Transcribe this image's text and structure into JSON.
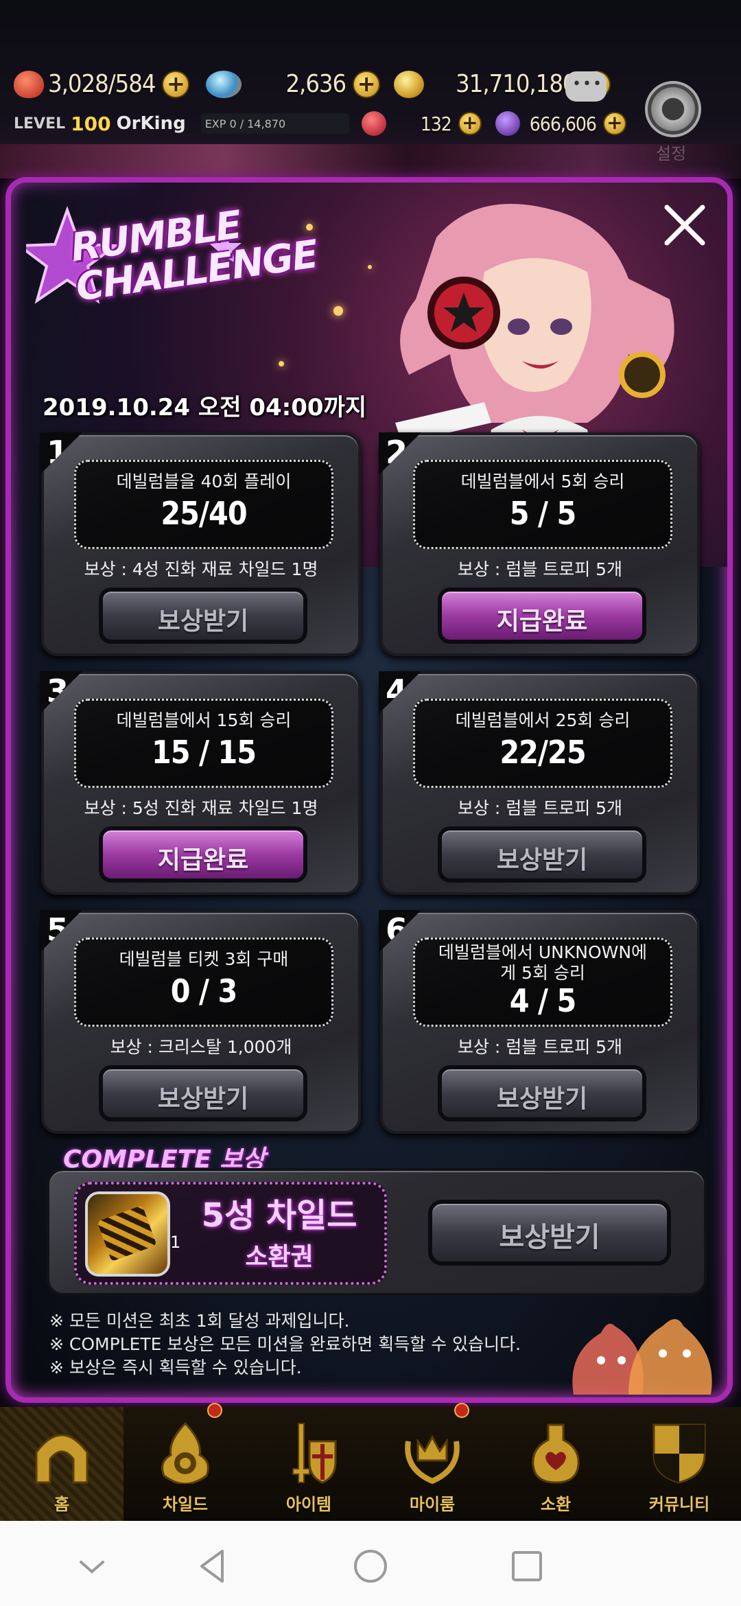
{
  "hud": {
    "hearts": "3,028",
    "hearts_max": "/584",
    "gems": "2,636",
    "coins": "31,710,180",
    "level_label": "LEVEL",
    "level": "100",
    "player_name": "OrKing",
    "exp": "EXP 0 / 14,870",
    "ruby": "132",
    "souls": "666,606",
    "settings_label": "설정"
  },
  "event": {
    "title_line1": "RUMBLE",
    "title_line2": "CHALLENGE",
    "deadline": "2019.10.24 오전 04:00까지"
  },
  "missions": [
    {
      "num": "1",
      "goal": "데빌럼블을 40회 플레이",
      "progress": "25/40",
      "reward": "보상 : 4성 진화 재료 차일드 1명",
      "button": "보상받기",
      "done": false
    },
    {
      "num": "2",
      "goal": "데빌럼블에서 5회 승리",
      "progress": "5 / 5",
      "reward": "보상 : 럼블 트로피 5개",
      "button": "지급완료",
      "done": true
    },
    {
      "num": "3",
      "goal": "데빌럼블에서 15회 승리",
      "progress": "15 / 15",
      "reward": "보상 : 5성 진화 재료 차일드 1명",
      "button": "지급완료",
      "done": true
    },
    {
      "num": "4",
      "goal": "데빌럼블에서 25회 승리",
      "progress": "22/25",
      "reward": "보상 : 럼블 트로피 5개",
      "button": "보상받기",
      "done": false
    },
    {
      "num": "5",
      "goal": "데빌럼블 티켓 3회 구매",
      "progress": "0 / 3",
      "reward": "보상 : 크리스탈 1,000개",
      "button": "보상받기",
      "done": false
    },
    {
      "num": "6",
      "goal": "데빌럼블에서 UNKNOWN에게 5회 승리",
      "progress": "4 / 5",
      "reward": "보상 : 럼블 트로피 5개",
      "button": "보상받기",
      "done": false
    }
  ],
  "complete": {
    "title": "COMPLETE 보상",
    "item_name": "5성 차일드",
    "item_sub": "소환권",
    "item_count": "1",
    "button": "보상받기"
  },
  "notes": [
    "모든 미션은 최초 1회 달성 과제입니다.",
    "COMPLETE 보상은 모든 미션을 완료하면 획득할 수 있습니다.",
    "보상은 즉시 획득할 수 있습니다."
  ],
  "nav": [
    {
      "label": "홈",
      "icon": "home-gate-icon",
      "active": true,
      "badge": false
    },
    {
      "label": "차일드",
      "icon": "child-flame-icon",
      "active": false,
      "badge": true
    },
    {
      "label": "아이템",
      "icon": "sword-shield-icon",
      "active": false,
      "badge": false
    },
    {
      "label": "마이룸",
      "icon": "crown-laurel-icon",
      "active": false,
      "badge": true
    },
    {
      "label": "소환",
      "icon": "potion-bottle-icon",
      "active": false,
      "badge": false
    },
    {
      "label": "커뮤니티",
      "icon": "checkered-shield-icon",
      "active": false,
      "badge": false
    }
  ],
  "colors": {
    "modal_border": "#a72bb0",
    "gold": "#e9c25a",
    "claimed_button": "#9c3aa2"
  }
}
